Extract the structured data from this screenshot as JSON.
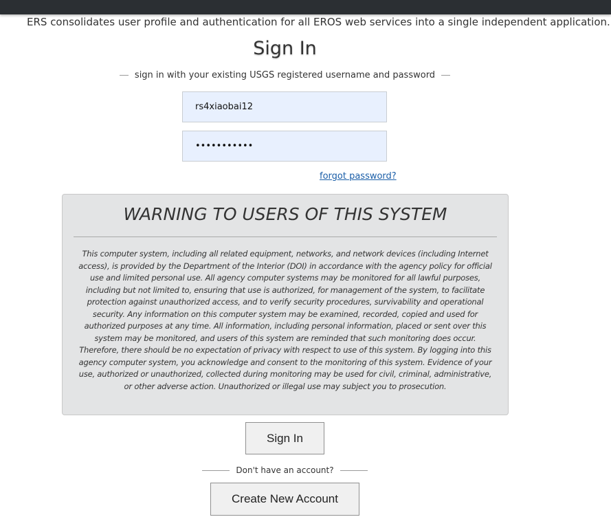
{
  "intro_text": "ERS consolidates user profile and authentication for all EROS web services into a single independent application.",
  "page_title": "Sign In",
  "subtitle": "sign in with your existing USGS registered username and password",
  "username_value": "rs4xiaobai12",
  "password_mask": "•••••••••••",
  "forgot_label": "forgot password?",
  "warning": {
    "title": "WARNING TO USERS OF THIS SYSTEM",
    "body": "This computer system, including all related equipment, networks, and network devices (including Internet access), is provided by the Department of the Interior (DOI) in accordance with the agency policy for official use and limited personal use. All agency computer systems may be monitored for all lawful purposes, including but not limited to, ensuring that use is authorized, for management of the system, to facilitate protection against unauthorized access, and to verify security procedures, survivability and operational security. Any information on this computer system may be examined, recorded, copied and used for authorized purposes at any time. All information, including personal information, placed or sent over this system may be monitored, and users of this system are reminded that such monitoring does occur. Therefore, there should be no expectation of privacy with respect to use of this system. By logging into this agency computer system, you acknowledge and consent to the monitoring of this system. Evidence of your use, authorized or unauthorized, collected during monitoring may be used for civil, criminal, administrative, or other adverse action. Unauthorized or illegal use may subject you to prosecution."
  },
  "signin_button_label": "Sign In",
  "no_account_text": "Don't have an account?",
  "create_account_label": "Create New Account",
  "colors": {
    "topbar": "#2b2f33",
    "field_background": "#e8f0fe",
    "warning_background": "#e3e4e5",
    "link": "#1a5ea8"
  }
}
